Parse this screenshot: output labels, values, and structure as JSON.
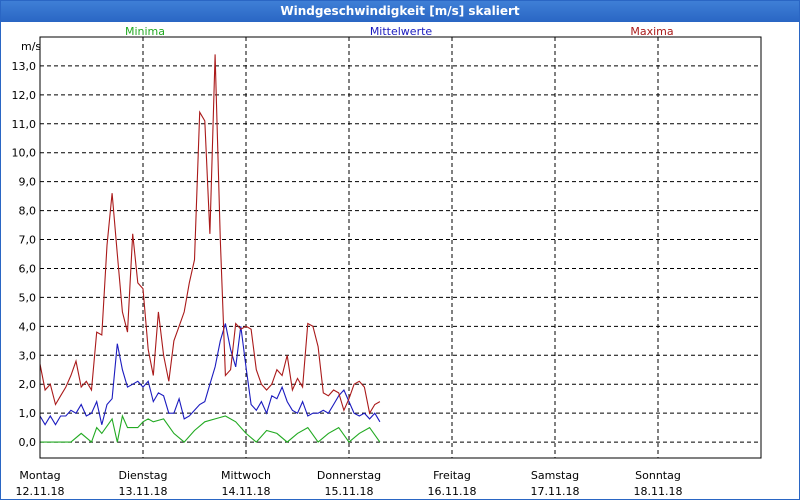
{
  "window": {
    "title": "Windgeschwindigkeit [m/s] skaliert"
  },
  "colors": {
    "minima": "#22aa22",
    "mittelwerte": "#1b1bbf",
    "maxima": "#aa1a1a",
    "titlebar": "#2a66c4"
  },
  "chart_data": {
    "type": "line",
    "title": "Windgeschwindigkeit [m/s] skaliert",
    "ylabel": "m/s",
    "xlabel": "",
    "ylim": [
      -0.55,
      14.0
    ],
    "yticks": [
      "0,0",
      "1,0",
      "2,0",
      "3,0",
      "4,0",
      "5,0",
      "6,0",
      "7,0",
      "8,0",
      "9,0",
      "10,0",
      "11,0",
      "12,0",
      "13,0"
    ],
    "ytick_values": [
      0,
      1,
      2,
      3,
      4,
      5,
      6,
      7,
      8,
      9,
      10,
      11,
      12,
      13
    ],
    "grid": true,
    "legend_placement": "top",
    "x_unit": "days from Montag 12.11.18 00:00",
    "xlim": [
      0,
      7
    ],
    "days": [
      {
        "name": "Montag",
        "date": "12.11.18"
      },
      {
        "name": "Dienstag",
        "date": "13.11.18"
      },
      {
        "name": "Mittwoch",
        "date": "14.11.18"
      },
      {
        "name": "Donnerstag",
        "date": "15.11.18"
      },
      {
        "name": "Freitag",
        "date": "16.11.18"
      },
      {
        "name": "Samstag",
        "date": "17.11.18"
      },
      {
        "name": "Sonntag",
        "date": "18.11.18"
      }
    ],
    "series": [
      {
        "name": "Minima",
        "color": "#22aa22",
        "x": [
          0.0,
          0.1,
          0.2,
          0.3,
          0.4,
          0.5,
          0.55,
          0.6,
          0.7,
          0.75,
          0.8,
          0.85,
          0.9,
          0.95,
          1.0,
          1.05,
          1.1,
          1.2,
          1.3,
          1.4,
          1.5,
          1.6,
          1.7,
          1.8,
          1.9,
          2.0,
          2.1,
          2.2,
          2.3,
          2.4,
          2.5,
          2.6,
          2.7,
          2.8,
          2.9,
          3.0,
          3.1,
          3.2,
          3.3
        ],
        "values": [
          0.0,
          0.0,
          0.0,
          0.0,
          0.3,
          0.0,
          0.5,
          0.3,
          0.8,
          0.0,
          0.9,
          0.5,
          0.5,
          0.5,
          0.7,
          0.8,
          0.7,
          0.8,
          0.3,
          0.0,
          0.4,
          0.7,
          0.8,
          0.9,
          0.7,
          0.3,
          0.0,
          0.4,
          0.3,
          0.0,
          0.3,
          0.5,
          0.0,
          0.3,
          0.5,
          0.0,
          0.3,
          0.5,
          0.0
        ]
      },
      {
        "name": "Mittelwerte",
        "color": "#1b1bbf",
        "x": [
          0.0,
          0.05,
          0.1,
          0.15,
          0.2,
          0.25,
          0.3,
          0.35,
          0.4,
          0.45,
          0.5,
          0.55,
          0.6,
          0.65,
          0.7,
          0.75,
          0.8,
          0.85,
          0.9,
          0.95,
          1.0,
          1.05,
          1.1,
          1.15,
          1.2,
          1.25,
          1.3,
          1.35,
          1.4,
          1.45,
          1.5,
          1.55,
          1.6,
          1.65,
          1.7,
          1.75,
          1.8,
          1.85,
          1.9,
          1.95,
          2.0,
          2.05,
          2.1,
          2.15,
          2.2,
          2.25,
          2.3,
          2.35,
          2.4,
          2.45,
          2.5,
          2.55,
          2.6,
          2.65,
          2.7,
          2.75,
          2.8,
          2.85,
          2.9,
          2.95,
          3.0,
          3.05,
          3.1,
          3.15,
          3.2,
          3.25,
          3.3
        ],
        "values": [
          0.9,
          0.6,
          0.9,
          0.6,
          0.9,
          0.9,
          1.1,
          1.0,
          1.3,
          0.9,
          1.0,
          1.4,
          0.6,
          1.3,
          1.5,
          3.4,
          2.5,
          1.9,
          2.0,
          2.1,
          1.9,
          2.1,
          1.4,
          1.7,
          1.6,
          1.0,
          1.0,
          1.5,
          0.8,
          0.9,
          1.1,
          1.3,
          1.4,
          2.0,
          2.6,
          3.5,
          4.1,
          3.2,
          2.6,
          4.0,
          2.6,
          1.3,
          1.1,
          1.4,
          1.0,
          1.6,
          1.5,
          1.9,
          1.4,
          1.1,
          1.0,
          1.4,
          0.9,
          1.0,
          1.0,
          1.1,
          1.0,
          1.3,
          1.6,
          1.8,
          1.4,
          1.0,
          0.9,
          1.0,
          0.8,
          1.0,
          0.7
        ]
      },
      {
        "name": "Maxima",
        "color": "#aa1a1a",
        "x": [
          0.0,
          0.05,
          0.1,
          0.15,
          0.2,
          0.25,
          0.3,
          0.35,
          0.4,
          0.45,
          0.5,
          0.55,
          0.6,
          0.65,
          0.7,
          0.75,
          0.8,
          0.85,
          0.9,
          0.95,
          1.0,
          1.05,
          1.1,
          1.15,
          1.2,
          1.25,
          1.3,
          1.35,
          1.4,
          1.45,
          1.5,
          1.55,
          1.6,
          1.65,
          1.7,
          1.75,
          1.8,
          1.85,
          1.9,
          1.95,
          2.0,
          2.05,
          2.1,
          2.15,
          2.2,
          2.25,
          2.3,
          2.35,
          2.4,
          2.45,
          2.5,
          2.55,
          2.6,
          2.65,
          2.7,
          2.75,
          2.8,
          2.85,
          2.9,
          2.95,
          3.0,
          3.05,
          3.1,
          3.15,
          3.2,
          3.25,
          3.3
        ],
        "values": [
          2.7,
          1.8,
          2.0,
          1.3,
          1.6,
          1.9,
          2.3,
          2.8,
          1.9,
          2.1,
          1.8,
          3.8,
          3.7,
          6.8,
          8.6,
          6.5,
          4.5,
          3.8,
          7.2,
          5.5,
          5.3,
          3.2,
          2.3,
          4.5,
          3.0,
          2.1,
          3.5,
          4.0,
          4.5,
          5.5,
          6.3,
          11.4,
          11.1,
          7.2,
          13.4,
          7.0,
          2.3,
          2.5,
          4.1,
          3.9,
          4.0,
          3.9,
          2.5,
          2.0,
          1.8,
          2.0,
          2.5,
          2.3,
          3.0,
          1.8,
          2.2,
          1.9,
          4.1,
          4.0,
          3.3,
          1.7,
          1.6,
          1.8,
          1.7,
          1.1,
          1.5,
          2.0,
          2.1,
          1.9,
          1.0,
          1.3,
          1.4
        ]
      }
    ]
  }
}
